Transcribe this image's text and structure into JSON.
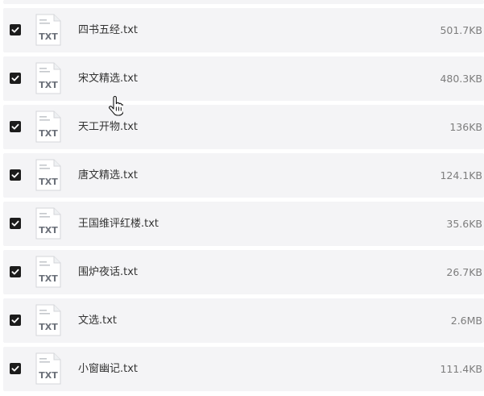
{
  "files": [
    {
      "name": "四书五经.txt",
      "size": "501.7KB",
      "checked": true,
      "type_label": "TXT"
    },
    {
      "name": "宋文精选.txt",
      "size": "480.3KB",
      "checked": true,
      "type_label": "TXT"
    },
    {
      "name": "天工开物.txt",
      "size": "136KB",
      "checked": true,
      "type_label": "TXT"
    },
    {
      "name": "唐文精选.txt",
      "size": "124.1KB",
      "checked": true,
      "type_label": "TXT"
    },
    {
      "name": "王国维评红楼.txt",
      "size": "35.6KB",
      "checked": true,
      "type_label": "TXT"
    },
    {
      "name": "围炉夜话.txt",
      "size": "26.7KB",
      "checked": true,
      "type_label": "TXT"
    },
    {
      "name": "文选.txt",
      "size": "2.6MB",
      "checked": true,
      "type_label": "TXT"
    },
    {
      "name": "小窗幽记.txt",
      "size": "111.4KB",
      "checked": true,
      "type_label": "TXT"
    }
  ],
  "icons": {
    "checkbox": "checkmark-icon",
    "file": "txt-file-icon",
    "cursor": "hand-pointer-icon"
  },
  "colors": {
    "row_background": "#f4f4f6",
    "checkbox_fill": "#1c1c1c",
    "name_text": "#333333",
    "size_text": "#7d7d7d"
  }
}
